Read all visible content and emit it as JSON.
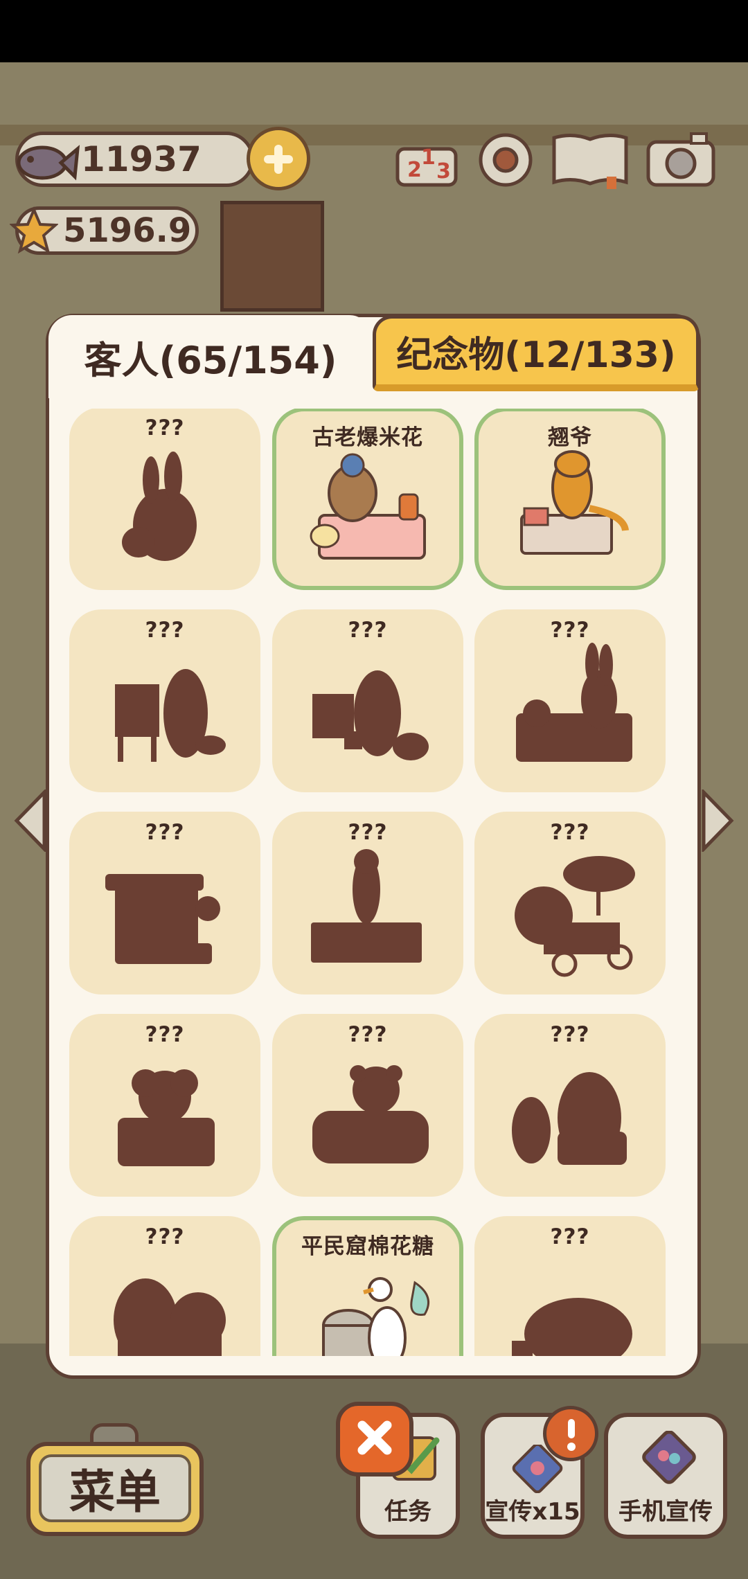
{
  "hud": {
    "fish_count": "11937",
    "star_count": "5196.9"
  },
  "tabs": [
    {
      "label": "客人(65/154)",
      "active": true
    },
    {
      "label": "纪念物(12/133)",
      "active": false
    }
  ],
  "cards": [
    {
      "title": "???",
      "found": false,
      "figure": "bunny"
    },
    {
      "title": "古老爆米花",
      "found": true,
      "figure": "popcorn-bear"
    },
    {
      "title": "翘爷",
      "found": true,
      "figure": "otter"
    },
    {
      "title": "???",
      "found": false,
      "figure": "easel-raccoon"
    },
    {
      "title": "???",
      "found": false,
      "figure": "easel-raccoon2"
    },
    {
      "title": "???",
      "found": false,
      "figure": "rabbit-stall"
    },
    {
      "title": "???",
      "found": false,
      "figure": "kiosk"
    },
    {
      "title": "???",
      "found": false,
      "figure": "duck-box"
    },
    {
      "title": "???",
      "found": false,
      "figure": "umbrella-bike"
    },
    {
      "title": "???",
      "found": false,
      "figure": "sheep"
    },
    {
      "title": "???",
      "found": false,
      "figure": "bear-sofa"
    },
    {
      "title": "???",
      "found": false,
      "figure": "duo"
    },
    {
      "title": "???",
      "found": false,
      "figure": "dog-cart"
    },
    {
      "title": "平民窟棉花糖",
      "found": true,
      "figure": "goose-candy"
    },
    {
      "title": "???",
      "found": false,
      "figure": "lump"
    }
  ],
  "bottom": {
    "menu_label": "菜单",
    "task_label": "任务",
    "promo_label": "宣传x15",
    "phone_promo_label": "手机宣传"
  },
  "colors": {
    "silhouette": "#6b3f33",
    "card_bg": "#f4e5c2",
    "found_border": "#9cc27b",
    "tab_inactive": "#f7c54c"
  }
}
